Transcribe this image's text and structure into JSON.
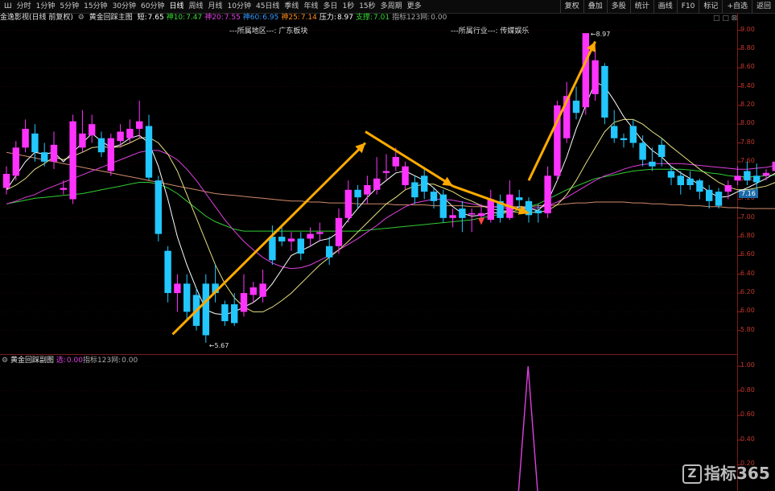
{
  "toolbar": {
    "menu_icon": "Ш",
    "periods": [
      "分时",
      "1分钟",
      "5分钟",
      "15分钟",
      "30分钟",
      "60分钟",
      "日线",
      "周线",
      "月线",
      "10分钟",
      "45日线",
      "季线",
      "年线",
      "多日",
      "1秒",
      "15秒",
      "多周期",
      "更多"
    ],
    "active_period": "日线",
    "right_buttons": [
      "复权",
      "叠加",
      "多股",
      "统计",
      "画线",
      "F10",
      "标记",
      "+自选",
      "返回"
    ]
  },
  "indicator_main": {
    "name": "金逸影视(日线 前复权)",
    "formula": "黄金回踩主图",
    "items": [
      {
        "label": "短:",
        "value": "7.65",
        "color": "#ffffff"
      },
      {
        "label": "神10:",
        "value": "7.47",
        "color": "#33dd33"
      },
      {
        "label": "神20:",
        "value": "7.55",
        "color": "#e040e0"
      },
      {
        "label": "神60:",
        "value": "6.95",
        "color": "#3399ff"
      },
      {
        "label": "神25:",
        "value": "7.14",
        "color": "#ff8c1a"
      },
      {
        "label": "压力:",
        "value": "8.97",
        "color": "#ffffff"
      },
      {
        "label": "支撑:",
        "value": "7.01",
        "color": "#33dd33"
      },
      {
        "label": "指标123网:",
        "value": "0.00",
        "color": "#aaaaaa"
      }
    ]
  },
  "region_label": "---所属地区---: 广东板块",
  "industry_label": "---所属行业---: 传媒娱乐",
  "window_controls": "□ □ ⊠",
  "main_axis": {
    "ticks": [
      "9.00",
      "8.80",
      "8.60",
      "8.40",
      "8.20",
      "8.00",
      "7.80",
      "7.60",
      "7.40",
      "7.20",
      "7.00",
      "6.80",
      "6.60",
      "6.40",
      "6.20",
      "6.00",
      "5.80"
    ],
    "last_price": "7.16"
  },
  "indicator_sub": {
    "name": "黄金回踩副图",
    "items": [
      {
        "label": "选:",
        "value": "0.00",
        "color": "#e040e0"
      },
      {
        "label": "指标123网:",
        "value": "0.00",
        "color": "#aaaaaa"
      }
    ]
  },
  "sub_axis": {
    "ticks": [
      "1.00",
      "0.80",
      "0.60",
      "0.40",
      "0.20"
    ]
  },
  "watermark": {
    "icon": "Z",
    "text": "指标365"
  },
  "chart_data": {
    "type": "candlestick",
    "ylim": [
      5.6,
      9.1
    ],
    "high_label": "8.97",
    "low_label": "5.67",
    "colors": {
      "up": "#ff33ff",
      "down": "#22c7ff",
      "ma_short": "#ffffff",
      "ma10": "#e6e080",
      "ma20": "#e040e0",
      "ma60": "#33cc33",
      "ma120": "#d08a6a",
      "arrow": "#ffaa00"
    },
    "candles": [
      {
        "o": 7.32,
        "c": 7.47,
        "h": 7.55,
        "l": 7.25
      },
      {
        "o": 7.45,
        "c": 7.75,
        "h": 7.82,
        "l": 7.4
      },
      {
        "o": 7.75,
        "c": 7.95,
        "h": 8.05,
        "l": 7.7
      },
      {
        "o": 7.9,
        "c": 7.7,
        "h": 8.0,
        "l": 7.6
      },
      {
        "o": 7.7,
        "c": 7.6,
        "h": 7.8,
        "l": 7.55
      },
      {
        "o": 7.6,
        "c": 7.78,
        "h": 7.92,
        "l": 7.52
      },
      {
        "o": 7.3,
        "c": 7.32,
        "h": 7.4,
        "l": 7.25
      },
      {
        "o": 7.2,
        "c": 8.03,
        "h": 8.1,
        "l": 7.15
      },
      {
        "o": 7.75,
        "c": 7.9,
        "h": 8.15,
        "l": 7.7
      },
      {
        "o": 7.88,
        "c": 8.0,
        "h": 8.1,
        "l": 7.8
      },
      {
        "o": 7.85,
        "c": 7.7,
        "h": 7.92,
        "l": 7.65
      },
      {
        "o": 7.5,
        "c": 7.85,
        "h": 7.9,
        "l": 7.45
      },
      {
        "o": 7.82,
        "c": 7.92,
        "h": 8.0,
        "l": 7.75
      },
      {
        "o": 7.85,
        "c": 7.95,
        "h": 8.05,
        "l": 7.8
      },
      {
        "o": 7.95,
        "c": 8.03,
        "h": 8.25,
        "l": 7.85
      },
      {
        "o": 7.98,
        "c": 7.43,
        "h": 8.1,
        "l": 7.4
      },
      {
        "o": 7.4,
        "c": 6.83,
        "h": 7.45,
        "l": 6.75
      },
      {
        "o": 6.65,
        "c": 6.2,
        "h": 6.7,
        "l": 6.1
      },
      {
        "o": 6.2,
        "c": 6.3,
        "h": 6.4,
        "l": 6.0
      },
      {
        "o": 6.3,
        "c": 6.0,
        "h": 6.4,
        "l": 5.9
      },
      {
        "o": 6.18,
        "c": 5.85,
        "h": 6.25,
        "l": 5.8
      },
      {
        "o": 6.3,
        "c": 5.75,
        "h": 6.4,
        "l": 5.67
      },
      {
        "o": 6.3,
        "c": 6.2,
        "h": 6.5,
        "l": 6.1
      },
      {
        "o": 6.08,
        "c": 5.9,
        "h": 6.12,
        "l": 5.85
      },
      {
        "o": 6.08,
        "c": 5.88,
        "h": 6.2,
        "l": 5.85
      },
      {
        "o": 6.0,
        "c": 6.2,
        "h": 6.4,
        "l": 5.95
      },
      {
        "o": 6.18,
        "c": 6.26,
        "h": 6.32,
        "l": 6.1
      },
      {
        "o": 6.16,
        "c": 6.3,
        "h": 6.45,
        "l": 6.1
      },
      {
        "o": 6.8,
        "c": 6.55,
        "h": 6.92,
        "l": 6.5
      },
      {
        "o": 6.8,
        "c": 6.75,
        "h": 6.9,
        "l": 6.7
      },
      {
        "o": 6.75,
        "c": 6.78,
        "h": 6.85,
        "l": 6.65
      },
      {
        "o": 6.78,
        "c": 6.62,
        "h": 6.85,
        "l": 6.55
      },
      {
        "o": 6.78,
        "c": 6.83,
        "h": 6.9,
        "l": 6.7
      },
      {
        "o": 6.83,
        "c": 6.85,
        "h": 6.95,
        "l": 6.75
      },
      {
        "o": 6.7,
        "c": 6.58,
        "h": 6.8,
        "l": 6.5
      },
      {
        "o": 6.7,
        "c": 7.0,
        "h": 7.1,
        "l": 6.62
      },
      {
        "o": 7.0,
        "c": 7.3,
        "h": 7.4,
        "l": 6.95
      },
      {
        "o": 7.3,
        "c": 7.22,
        "h": 7.35,
        "l": 7.1
      },
      {
        "o": 7.25,
        "c": 7.35,
        "h": 7.45,
        "l": 7.15
      },
      {
        "o": 7.3,
        "c": 7.42,
        "h": 7.65,
        "l": 7.25
      },
      {
        "o": 7.48,
        "c": 7.5,
        "h": 7.68,
        "l": 7.4
      },
      {
        "o": 7.55,
        "c": 7.65,
        "h": 7.75,
        "l": 7.5
      },
      {
        "o": 7.35,
        "c": 7.55,
        "h": 7.6,
        "l": 7.3
      },
      {
        "o": 7.38,
        "c": 7.22,
        "h": 7.45,
        "l": 7.15
      },
      {
        "o": 7.45,
        "c": 7.28,
        "h": 7.52,
        "l": 7.2
      },
      {
        "o": 7.28,
        "c": 7.18,
        "h": 7.32,
        "l": 7.1
      },
      {
        "o": 7.25,
        "c": 7.0,
        "h": 7.3,
        "l": 6.95
      },
      {
        "o": 7.0,
        "c": 7.03,
        "h": 7.1,
        "l": 6.9
      },
      {
        "o": 7.1,
        "c": 7.0,
        "h": 7.18,
        "l": 6.85
      },
      {
        "o": 7.05,
        "c": 7.05,
        "h": 7.1,
        "l": 6.85
      },
      {
        "o": 7.02,
        "c": 7.05,
        "h": 7.15,
        "l": 6.95
      },
      {
        "o": 6.98,
        "c": 7.2,
        "h": 7.3,
        "l": 6.95
      },
      {
        "o": 7.18,
        "c": 7.0,
        "h": 7.25,
        "l": 6.95
      },
      {
        "o": 7.0,
        "c": 7.25,
        "h": 7.4,
        "l": 6.98
      },
      {
        "o": 7.22,
        "c": 7.19,
        "h": 7.3,
        "l": 7.1
      },
      {
        "o": 7.18,
        "c": 7.03,
        "h": 7.22,
        "l": 6.95
      },
      {
        "o": 7.08,
        "c": 7.05,
        "h": 7.15,
        "l": 6.95
      },
      {
        "o": 7.05,
        "c": 7.45,
        "h": 7.55,
        "l": 7.0
      },
      {
        "o": 7.45,
        "c": 8.2,
        "h": 8.25,
        "l": 7.4
      },
      {
        "o": 7.85,
        "c": 8.3,
        "h": 8.45,
        "l": 7.8
      },
      {
        "o": 8.25,
        "c": 8.12,
        "h": 8.4,
        "l": 8.05
      },
      {
        "o": 8.18,
        "c": 8.97,
        "h": 8.97,
        "l": 8.1
      },
      {
        "o": 8.32,
        "c": 8.68,
        "h": 8.8,
        "l": 8.25
      },
      {
        "o": 8.62,
        "c": 8.07,
        "h": 8.65,
        "l": 8.0
      },
      {
        "o": 7.98,
        "c": 7.85,
        "h": 8.15,
        "l": 7.8
      },
      {
        "o": 7.85,
        "c": 7.83,
        "h": 7.9,
        "l": 7.75
      },
      {
        "o": 7.98,
        "c": 7.8,
        "h": 8.05,
        "l": 7.75
      },
      {
        "o": 7.8,
        "c": 7.62,
        "h": 7.88,
        "l": 7.55
      },
      {
        "o": 7.6,
        "c": 7.55,
        "h": 7.75,
        "l": 7.5
      },
      {
        "o": 7.78,
        "c": 7.65,
        "h": 7.85,
        "l": 7.55
      },
      {
        "o": 7.5,
        "c": 7.43,
        "h": 7.55,
        "l": 7.35
      },
      {
        "o": 7.45,
        "c": 7.35,
        "h": 7.5,
        "l": 7.25
      },
      {
        "o": 7.42,
        "c": 7.35,
        "h": 7.5,
        "l": 7.3
      },
      {
        "o": 7.4,
        "c": 7.28,
        "h": 7.42,
        "l": 7.2
      },
      {
        "o": 7.3,
        "c": 7.18,
        "h": 7.35,
        "l": 7.1
      },
      {
        "o": 7.28,
        "c": 7.13,
        "h": 7.32,
        "l": 7.1
      },
      {
        "o": 7.28,
        "c": 7.35,
        "h": 7.4,
        "l": 7.2
      },
      {
        "o": 7.4,
        "c": 7.45,
        "h": 7.55,
        "l": 7.35
      },
      {
        "o": 7.5,
        "c": 7.4,
        "h": 7.6,
        "l": 7.35
      },
      {
        "o": 7.45,
        "c": 7.38,
        "h": 7.58,
        "l": 7.3
      },
      {
        "o": 7.45,
        "c": 7.48,
        "h": 7.52,
        "l": 7.4
      },
      {
        "o": 7.5,
        "c": 7.6,
        "h": 7.65,
        "l": 7.45
      },
      {
        "o": 7.6,
        "c": 7.75,
        "h": 7.9,
        "l": 7.55
      },
      {
        "o": 7.72,
        "c": 7.78,
        "h": 7.85,
        "l": 7.65
      }
    ],
    "ma_short": [
      7.3,
      7.45,
      7.6,
      7.7,
      7.68,
      7.7,
      7.6,
      7.7,
      7.8,
      7.9,
      7.82,
      7.75,
      7.78,
      7.85,
      7.88,
      7.8,
      7.55,
      7.2,
      6.8,
      6.5,
      6.25,
      6.02,
      5.98,
      5.97,
      6.0,
      6.05,
      6.1,
      6.18,
      6.3,
      6.45,
      6.6,
      6.65,
      6.7,
      6.76,
      6.78,
      6.85,
      6.98,
      7.1,
      7.22,
      7.32,
      7.4,
      7.48,
      7.5,
      7.45,
      7.4,
      7.32,
      7.22,
      7.12,
      7.05,
      7.02,
      7.03,
      7.06,
      7.05,
      7.08,
      7.12,
      7.1,
      7.08,
      7.18,
      7.4,
      7.65,
      7.95,
      8.2,
      8.45,
      8.4,
      8.25,
      8.08,
      7.95,
      7.82,
      7.72,
      7.65,
      7.55,
      7.48,
      7.42,
      7.35,
      7.28,
      7.22,
      7.23,
      7.28,
      7.32,
      7.37,
      7.42,
      7.48,
      7.58,
      7.66
    ],
    "ma10": [
      7.3,
      7.35,
      7.42,
      7.52,
      7.58,
      7.65,
      7.62,
      7.66,
      7.7,
      7.75,
      7.76,
      7.75,
      7.76,
      7.8,
      7.85,
      7.86,
      7.8,
      7.68,
      7.5,
      7.25,
      7.0,
      6.75,
      6.5,
      6.3,
      6.15,
      6.05,
      6.0,
      6.0,
      6.05,
      6.12,
      6.2,
      6.3,
      6.4,
      6.5,
      6.58,
      6.66,
      6.75,
      6.85,
      6.95,
      7.05,
      7.15,
      7.22,
      7.3,
      7.34,
      7.36,
      7.36,
      7.32,
      7.28,
      7.22,
      7.18,
      7.13,
      7.1,
      7.08,
      7.07,
      7.06,
      7.06,
      7.06,
      7.08,
      7.14,
      7.25,
      7.4,
      7.58,
      7.75,
      7.92,
      8.02,
      8.05,
      8.05,
      8.0,
      7.92,
      7.85,
      7.76,
      7.68,
      7.6,
      7.52,
      7.45,
      7.38,
      7.33,
      7.3,
      7.3,
      7.32,
      7.34,
      7.38,
      7.43,
      7.5
    ],
    "ma20": [
      7.15,
      7.18,
      7.22,
      7.25,
      7.3,
      7.34,
      7.38,
      7.42,
      7.46,
      7.5,
      7.54,
      7.58,
      7.62,
      7.66,
      7.7,
      7.72,
      7.72,
      7.68,
      7.62,
      7.52,
      7.4,
      7.26,
      7.12,
      6.98,
      6.86,
      6.75,
      6.66,
      6.58,
      6.52,
      6.48,
      6.46,
      6.47,
      6.5,
      6.55,
      6.6,
      6.66,
      6.72,
      6.78,
      6.85,
      6.92,
      7.0,
      7.06,
      7.12,
      7.16,
      7.18,
      7.2,
      7.2,
      7.19,
      7.17,
      7.15,
      7.13,
      7.12,
      7.11,
      7.1,
      7.1,
      7.1,
      7.11,
      7.13,
      7.17,
      7.22,
      7.28,
      7.34,
      7.4,
      7.45,
      7.48,
      7.52,
      7.55,
      7.57,
      7.58,
      7.58,
      7.58,
      7.58,
      7.57,
      7.56,
      7.55,
      7.54,
      7.53,
      7.52,
      7.52,
      7.53,
      7.54,
      7.56,
      7.58,
      7.6
    ],
    "ma60": [
      7.15,
      7.17,
      7.19,
      7.21,
      7.22,
      7.23,
      7.24,
      7.25,
      7.26,
      7.28,
      7.3,
      7.32,
      7.34,
      7.36,
      7.38,
      7.38,
      7.36,
      7.32,
      7.26,
      7.18,
      7.1,
      7.02,
      6.96,
      6.92,
      6.88,
      6.86,
      6.86,
      6.86,
      6.86,
      6.86,
      6.86,
      6.86,
      6.86,
      6.86,
      6.86,
      6.86,
      6.86,
      6.86,
      6.87,
      6.88,
      6.89,
      6.9,
      6.91,
      6.92,
      6.93,
      6.94,
      6.95,
      6.96,
      6.97,
      6.98,
      7.0,
      7.02,
      7.04,
      7.06,
      7.09,
      7.12,
      7.15,
      7.2,
      7.25,
      7.3,
      7.34,
      7.38,
      7.42,
      7.44,
      7.46,
      7.48,
      7.5,
      7.51,
      7.52,
      7.52,
      7.52,
      7.52,
      7.51,
      7.5,
      7.48,
      7.47,
      7.45,
      7.44,
      7.44,
      7.44,
      7.45,
      7.46,
      7.48,
      7.5
    ],
    "ma120": [
      7.7,
      7.68,
      7.66,
      7.64,
      7.62,
      7.6,
      7.58,
      7.56,
      7.54,
      7.52,
      7.5,
      7.48,
      7.46,
      7.44,
      7.42,
      7.4,
      7.38,
      7.36,
      7.34,
      7.32,
      7.3,
      7.28,
      7.26,
      7.25,
      7.24,
      7.23,
      7.22,
      7.21,
      7.2,
      7.19,
      7.18,
      7.18,
      7.17,
      7.17,
      7.16,
      7.16,
      7.16,
      7.15,
      7.15,
      7.15,
      7.15,
      7.14,
      7.14,
      7.14,
      7.14,
      7.13,
      7.13,
      7.13,
      7.13,
      7.12,
      7.12,
      7.12,
      7.12,
      7.12,
      7.12,
      7.12,
      7.13,
      7.13,
      7.14,
      7.15,
      7.16,
      7.16,
      7.17,
      7.17,
      7.17,
      7.17,
      7.16,
      7.16,
      7.15,
      7.15,
      7.14,
      7.14,
      7.13,
      7.13,
      7.12,
      7.12,
      7.11,
      7.11,
      7.1,
      7.1,
      7.1,
      7.1,
      7.1,
      7.1
    ],
    "signal_sub": {
      "ylim": [
        0,
        1.1
      ],
      "values_index": 54,
      "peak": 1.0
    },
    "arrows": [
      {
        "from": [
          17.5,
          5.76
        ],
        "to": [
          37.8,
          7.8
        ]
      },
      {
        "from": [
          37.8,
          7.92
        ],
        "to": [
          47,
          7.34
        ]
      },
      {
        "from": [
          47,
          7.34
        ],
        "to": [
          55,
          7.05
        ]
      },
      {
        "from": [
          55,
          7.4
        ],
        "to": [
          62,
          8.88
        ]
      }
    ]
  }
}
